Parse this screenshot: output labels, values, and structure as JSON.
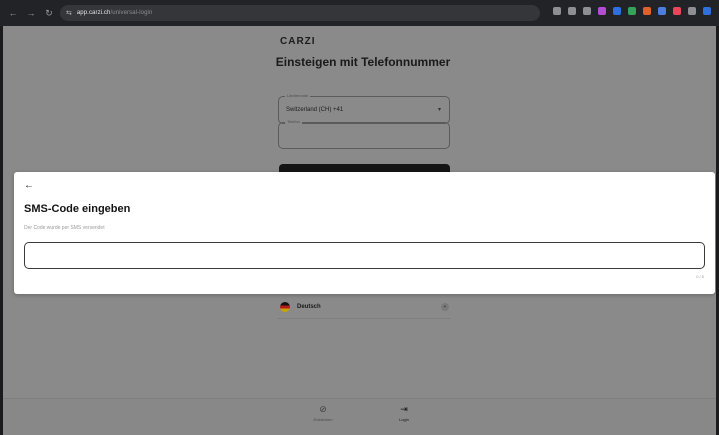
{
  "browser": {
    "nav": {
      "back": "←",
      "forward": "→",
      "reload": "↻"
    },
    "url_host": "app.carzi.ch",
    "url_path": "/universal-login",
    "site_icon": "⇆",
    "extension_colors": [
      "#8d8f93",
      "#8d8f93",
      "#8d8f93",
      "#b04fd4",
      "#2f6fe0",
      "#36a35a",
      "#e2602d",
      "#4a7fe0",
      "#e8465a",
      "#8d8f93",
      "#2f6fe0"
    ]
  },
  "page": {
    "logo": "CARZI",
    "heading": "Einsteigen mit Telefonnummer",
    "country_label": "Ländercode",
    "country_value": "Switzerland (CH) +41",
    "phone_label": "Telefon",
    "language_label": "Deutsch",
    "language_toggle": "+",
    "bottom_nav": [
      {
        "label": "Entdecken",
        "icon": "⊘",
        "icon_name": "compass-icon"
      },
      {
        "label": "Login",
        "icon": "⇥",
        "icon_name": "login-icon"
      }
    ]
  },
  "modal": {
    "back_icon": "←",
    "title": "SMS-Code eingeben",
    "subtitle": "Der Code wurde per SMS versendet",
    "code_value": "",
    "counter": "0 / 6"
  },
  "colors": {
    "overlay": "#8a8a8a",
    "modal_bg": "#ffffff",
    "cta": "#151515"
  }
}
